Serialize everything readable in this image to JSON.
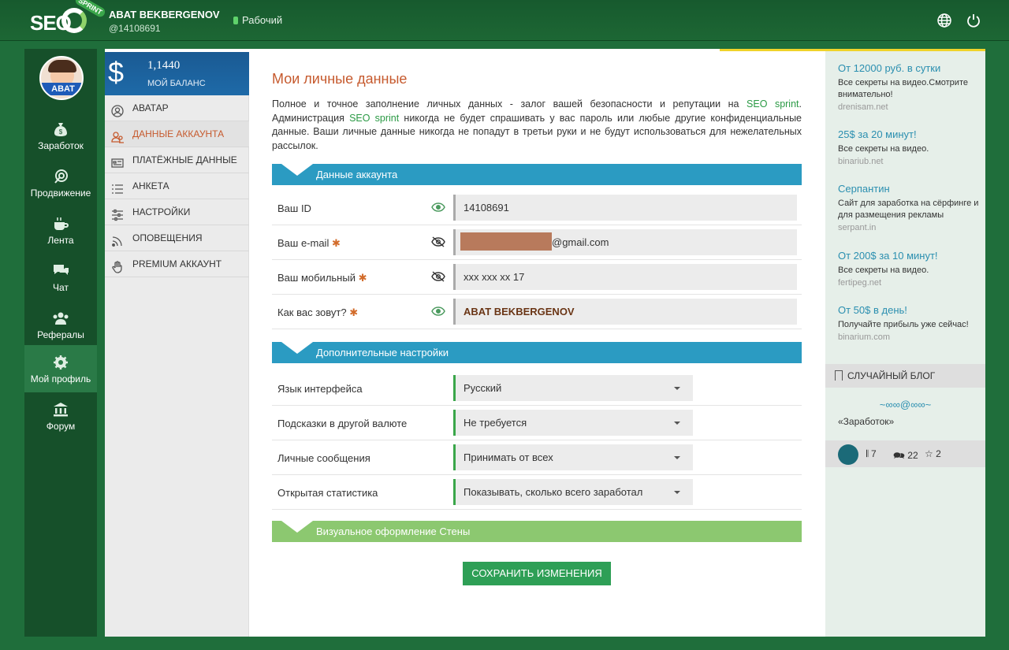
{
  "brand": {
    "logo_text": "SEO",
    "logo_badge": "SPRINT"
  },
  "header": {
    "user_name": "ABAT BEKBERGENOV",
    "user_id": "@14108691",
    "status": "Рабочий"
  },
  "rail": {
    "avatar_tag": "ABAT",
    "items": [
      {
        "label": "Заработок",
        "icon": "money-bag-icon"
      },
      {
        "label": "Продвижение",
        "icon": "target-icon"
      },
      {
        "label": "Лента",
        "icon": "coffee-icon"
      },
      {
        "label": "Чат",
        "icon": "chat-icon"
      },
      {
        "label": "Рефералы",
        "icon": "users-icon"
      },
      {
        "label": "Мой профиль",
        "icon": "gear-icon"
      },
      {
        "label": "Форум",
        "icon": "bank-icon"
      }
    ]
  },
  "balance": {
    "symbol": "$",
    "amount": "1,1440",
    "label": "МОЙ БАЛАНС"
  },
  "menu": [
    {
      "label": "АВАТАР",
      "icon": "user-circle-icon"
    },
    {
      "label": "ДАННЫЕ АККАУНТА",
      "icon": "users-icon"
    },
    {
      "label": "ПЛАТЁЖНЫЕ ДАННЫЕ",
      "icon": "card-icon"
    },
    {
      "label": "АНКЕТА",
      "icon": "list-icon"
    },
    {
      "label": "НАСТРОЙКИ",
      "icon": "sliders-icon"
    },
    {
      "label": "ОПОВЕЩЕНИЯ",
      "icon": "rss-icon"
    },
    {
      "label": "PREMIUM АККАУНТ",
      "icon": "hand-icon"
    }
  ],
  "page": {
    "title": "Мои личные данные",
    "intro_1": "Полное и точное заполнение личных данных - залог вашей безопасности и репутации на ",
    "intro_brand_1": "SEO sprint",
    "intro_2": ". Администрация ",
    "intro_brand_2": "SEO sprint",
    "intro_3": " никогда не будет спрашивать у вас пароль или любые другие конфиденциальные данные. Ваши личные данные никогда не попадут в третьи руки и не будут использоваться для нежелательных рассылок."
  },
  "sections": {
    "account": "Данные аккаунта",
    "extra": "Дополнительные настройки",
    "wall": "Визуальное оформление Стены"
  },
  "account_fields": [
    {
      "label": "Ваш ID",
      "required": false,
      "value": "14108691",
      "visible": true
    },
    {
      "label": "Ваш e-mail",
      "required": true,
      "value": "@gmail.com",
      "visible": false
    },
    {
      "label": "Ваш мобильный",
      "required": true,
      "value": "xxx xxx xx 17",
      "visible": false
    },
    {
      "label": "Как вас зовут?",
      "required": true,
      "value": "ABAT BEKBERGENOV",
      "visible": true
    }
  ],
  "settings": [
    {
      "label": "Язык интерфейса",
      "value": "Русский"
    },
    {
      "label": "Подсказки в другой валюте",
      "value": "Не требуется"
    },
    {
      "label": "Личные сообщения",
      "value": "Принимать от всех"
    },
    {
      "label": "Открытая статистика",
      "value": "Показывать, сколько всего заработал"
    }
  ],
  "save_label": "СОХРАНИТЬ ИЗМЕНЕНИЯ",
  "ads": [
    {
      "title": "От 12000 руб. в сутки",
      "desc": "Все секреты на видео.Смотрите внимательно!",
      "site": "drenisam.net"
    },
    {
      "title": "25$ за 20 минут!",
      "desc": "Все секреты на видео.",
      "site": "binariub.net"
    },
    {
      "title": "Серпантин",
      "desc": "Сайт для заработка на сёрфинге и для размещения рекламы",
      "site": "serpant.in"
    },
    {
      "title": "От 200$ за 10 минут!",
      "desc": "Все секреты на видео.",
      "site": "fertipeg.net"
    },
    {
      "title": "От 50$ в день!",
      "desc": "Получайте прибыль уже сейчас!",
      "site": "binarium.com"
    }
  ],
  "blog": {
    "header": "СЛУЧАЙНЫЙ БЛОГ",
    "ornament": "~∞∞@∞∞~",
    "title": "«Заработок»",
    "posts": "7",
    "comments": "22",
    "stars": "2"
  },
  "colors": {
    "accent": "#c65a2e",
    "section_blue": "#2b9bc2",
    "section_green": "#8cc870",
    "button": "#2e9f56",
    "rail": "#16502a"
  }
}
